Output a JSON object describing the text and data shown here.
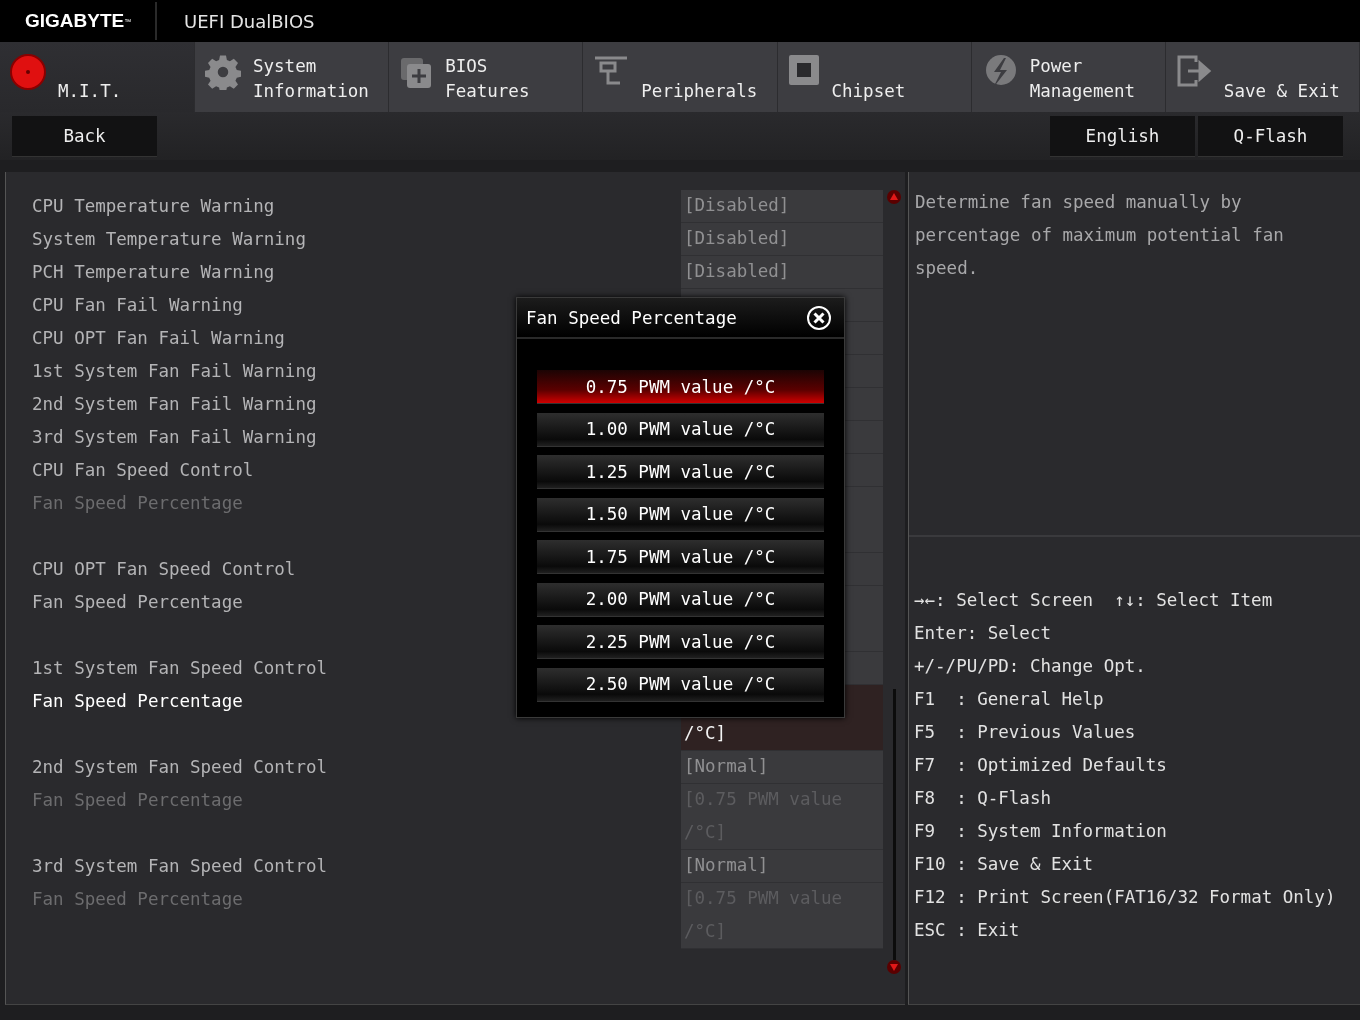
{
  "header": {
    "logo": "GIGABYTE$^{™}$",
    "title": "UEFI DualBIOS"
  },
  "tabs": [
    {
      "lines": [
        "M.I.T."
      ],
      "selected": true
    },
    {
      "lines": [
        "System",
        "Information"
      ],
      "selected": false
    },
    {
      "lines": [
        "BIOS",
        "Features"
      ],
      "selected": false
    },
    {
      "lines": [
        "Peripherals"
      ],
      "selected": false
    },
    {
      "lines": [
        "Chipset"
      ],
      "selected": false
    },
    {
      "lines": [
        "Power",
        "Management"
      ],
      "selected": false
    },
    {
      "lines": [
        "Save & Exit"
      ],
      "selected": false
    }
  ],
  "back_button": "Back",
  "right_buttons": [
    "English",
    "Q-Flash"
  ],
  "settings": [
    {
      "kind": "control",
      "label": "CPU Temperature Warning",
      "value": "[Disabled]",
      "disabled": false,
      "selected": false
    },
    {
      "kind": "control",
      "label": "System Temperature Warning",
      "value": "[Disabled]",
      "disabled": false,
      "selected": false
    },
    {
      "kind": "control",
      "label": "PCH Temperature Warning",
      "value": "[Disabled]",
      "disabled": false,
      "selected": false
    },
    {
      "kind": "control",
      "label": "CPU Fan Fail Warning",
      "disabled": false,
      "selected": false
    },
    {
      "kind": "control",
      "label": "CPU OPT Fan Fail Warning",
      "disabled": false,
      "selected": false
    },
    {
      "kind": "control",
      "label": "1st System Fan Fail Warning",
      "disabled": false,
      "selected": false
    },
    {
      "kind": "control",
      "label": "2nd System Fan Fail Warning",
      "disabled": false,
      "selected": false
    },
    {
      "kind": "control",
      "label": "3rd System Fan Fail Warning",
      "disabled": false,
      "selected": false
    },
    {
      "kind": "control",
      "label": "CPU Fan Speed Control",
      "disabled": false,
      "selected": false
    },
    {
      "kind": "percentage",
      "label": "Fan Speed Percentage",
      "disabled": true,
      "selected": false
    },
    {
      "kind": "control",
      "label": "CPU OPT Fan Speed Control",
      "disabled": false,
      "selected": false
    },
    {
      "kind": "percentage",
      "label": "Fan Speed Percentage",
      "disabled": false,
      "selected": false
    },
    {
      "kind": "control",
      "label": "1st System Fan Speed Control",
      "disabled": false,
      "selected": false
    },
    {
      "kind": "percentage",
      "label": "Fan Speed Percentage",
      "value": "/°C]",
      "disabled": false,
      "selected": true
    },
    {
      "kind": "control",
      "label": "2nd System Fan Speed Control",
      "value": "[Normal]",
      "disabled": false,
      "selected": false
    },
    {
      "kind": "percentage",
      "label": "Fan Speed Percentage",
      "value": "[0.75 PWM value /°C]",
      "disabled": true,
      "selected": false
    },
    {
      "kind": "control",
      "label": "3rd System Fan Speed Control",
      "value": "[Normal]",
      "disabled": false,
      "selected": false
    },
    {
      "kind": "percentage",
      "label": "Fan Speed Percentage",
      "value": "[0.75 PWM value /°C]",
      "disabled": true,
      "selected": false
    }
  ],
  "popup": {
    "title": "Fan Speed Percentage",
    "options": [
      {
        "label": "0.75 PWM value /°C",
        "selected": true
      },
      {
        "label": "1.00 PWM value /°C",
        "selected": false
      },
      {
        "label": "1.25 PWM value /°C",
        "selected": false
      },
      {
        "label": "1.50 PWM value /°C",
        "selected": false
      },
      {
        "label": "1.75 PWM value /°C",
        "selected": false
      },
      {
        "label": "2.00 PWM value /°C",
        "selected": false
      },
      {
        "label": "2.25 PWM value /°C",
        "selected": false
      },
      {
        "label": "2.50 PWM value /°C",
        "selected": false
      }
    ]
  },
  "help": {
    "description": "Determine fan speed manually by percentage of maximum potential fan speed.",
    "nav": [
      "→←: Select Screen",
      "↑↓: Select Item"
    ],
    "keys": [
      "Enter: Select",
      "+/-/PU/PD: Change Opt.",
      "F1  : General Help",
      "F5  : Previous Values",
      "F7  : Optimized Defaults",
      "F8  : Q-Flash",
      "F9  : System Information",
      "F10 : Save & Exit",
      "F12 : Print Screen(FAT16/32 Format Only)",
      "ESC : Exit"
    ]
  }
}
